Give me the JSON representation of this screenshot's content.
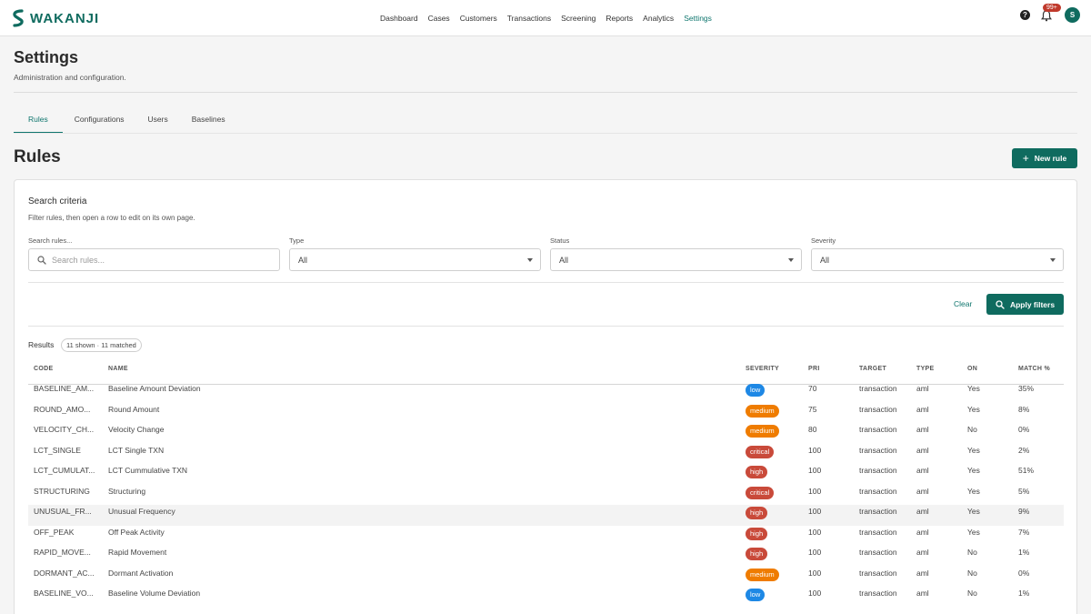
{
  "app": {
    "logo_text": "WAKANJI",
    "nav": [
      "Dashboard",
      "Cases",
      "Customers",
      "Transactions",
      "Screening",
      "Reports",
      "Analytics",
      "Settings"
    ],
    "nav_active": "Settings",
    "notifications_badge": "99+",
    "user_initial": "S",
    "help_glyph": "?"
  },
  "page": {
    "title": "Settings",
    "subtitle": "Administration and configuration."
  },
  "tabs": [
    "Rules",
    "Configurations",
    "Users",
    "Baselines"
  ],
  "rules": {
    "title": "Rules",
    "new_button": "New rule"
  },
  "search": {
    "title": "Search criteria",
    "subtitle": "Filter rules, then open a row to edit on its own page.",
    "search_label": "Search rules...",
    "search_placeholder": "Search rules...",
    "type_label": "Type",
    "type_value": "All",
    "status_label": "Status",
    "status_value": "All",
    "severity_label": "Severity",
    "severity_value": "All",
    "clear_label": "Clear",
    "apply_label": "Apply filters"
  },
  "results": {
    "label": "Results",
    "pill": "11 shown · 11 matched"
  },
  "table": {
    "columns": [
      "CODE",
      "NAME",
      "SEVERITY",
      "PRI",
      "TARGET",
      "TYPE",
      "ON",
      "MATCH %"
    ],
    "rows": [
      {
        "code": "BASELINE_AM...",
        "name": "Baseline Amount Deviation",
        "severity": "low",
        "pri": "70",
        "target": "transaction",
        "type": "aml",
        "on": "Yes",
        "match": "35%"
      },
      {
        "code": "ROUND_AMO...",
        "name": "Round Amount",
        "severity": "medium",
        "pri": "75",
        "target": "transaction",
        "type": "aml",
        "on": "Yes",
        "match": "8%"
      },
      {
        "code": "VELOCITY_CH...",
        "name": "Velocity Change",
        "severity": "medium",
        "pri": "80",
        "target": "transaction",
        "type": "aml",
        "on": "No",
        "match": "0%"
      },
      {
        "code": "LCT_SINGLE",
        "name": "LCT Single TXN",
        "severity": "critical",
        "pri": "100",
        "target": "transaction",
        "type": "aml",
        "on": "Yes",
        "match": "2%"
      },
      {
        "code": "LCT_CUMULAT...",
        "name": "LCT Cummulative TXN",
        "severity": "high",
        "pri": "100",
        "target": "transaction",
        "type": "aml",
        "on": "Yes",
        "match": "51%"
      },
      {
        "code": "STRUCTURING",
        "name": "Structuring",
        "severity": "critical",
        "pri": "100",
        "target": "transaction",
        "type": "aml",
        "on": "Yes",
        "match": "5%"
      },
      {
        "code": "UNUSUAL_FR...",
        "name": "Unusual Frequency",
        "severity": "high",
        "pri": "100",
        "target": "transaction",
        "type": "aml",
        "on": "Yes",
        "match": "9%"
      },
      {
        "code": "OFF_PEAK",
        "name": "Off Peak Activity",
        "severity": "high",
        "pri": "100",
        "target": "transaction",
        "type": "aml",
        "on": "Yes",
        "match": "7%"
      },
      {
        "code": "RAPID_MOVE...",
        "name": "Rapid Movement",
        "severity": "high",
        "pri": "100",
        "target": "transaction",
        "type": "aml",
        "on": "No",
        "match": "1%"
      },
      {
        "code": "DORMANT_AC...",
        "name": "Dormant Activation",
        "severity": "medium",
        "pri": "100",
        "target": "transaction",
        "type": "aml",
        "on": "No",
        "match": "0%"
      },
      {
        "code": "BASELINE_VO...",
        "name": "Baseline Volume Deviation",
        "severity": "low",
        "pri": "100",
        "target": "transaction",
        "type": "aml",
        "on": "No",
        "match": "1%"
      }
    ]
  },
  "colors": {
    "brand": "#0f6b5f",
    "low": "#1e88e5",
    "medium": "#ef7c00",
    "high": "#c94a3a",
    "critical": "#c94a3a"
  }
}
